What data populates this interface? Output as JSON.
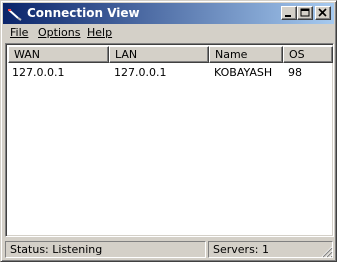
{
  "window": {
    "title": "Connection View",
    "icon": "app-icon",
    "controls": [
      "minimize-icon",
      "maximize-icon",
      "close-icon"
    ]
  },
  "menu": {
    "file_label": "File",
    "options_label": "Options",
    "help_label": "Help"
  },
  "table": {
    "columns": [
      "WAN",
      "LAN",
      "Name",
      "OS"
    ],
    "rows": [
      [
        "127.0.0.1",
        "127.0.0.1",
        "KOBAYASH",
        "98"
      ]
    ]
  },
  "status": {
    "state": "Status: Listening",
    "servers": "Servers: 1"
  },
  "colors": {
    "titlebar_start": "#0a246a",
    "titlebar_end": "#a6caf0",
    "face": "#d4d0c8"
  }
}
